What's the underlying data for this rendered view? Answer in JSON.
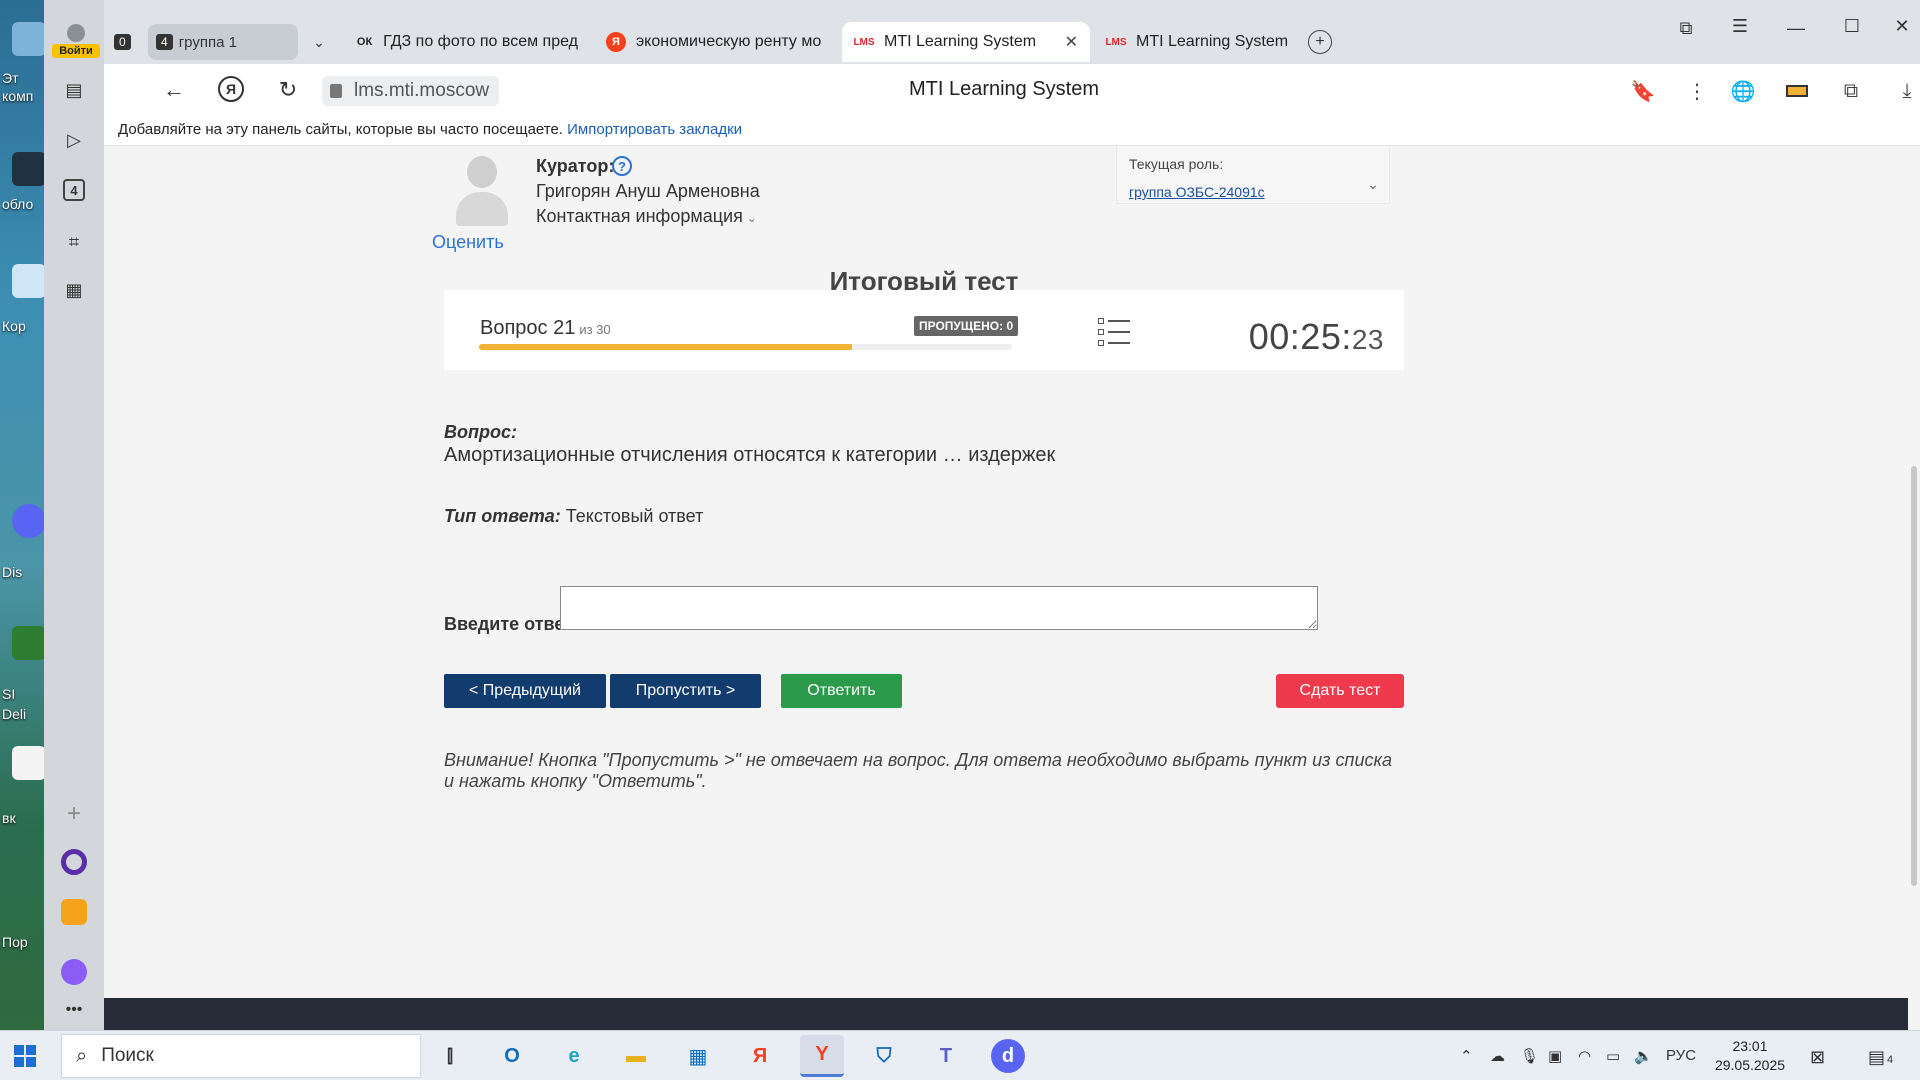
{
  "desktop": {
    "labels": [
      "Эт",
      "комп",
      "обло",
      "Кор",
      "Dis",
      "SI",
      "Deli",
      "вк",
      "Пор"
    ]
  },
  "browser": {
    "login_label": "Войти",
    "tab_group": {
      "count": "4",
      "label": "группа 1"
    },
    "tab_counter": "0",
    "tabs": [
      {
        "label": "ГДЗ по фото по всем пред",
        "icon": "ok-icon",
        "icon_text": "ОК"
      },
      {
        "label": "экономическую ренту мо",
        "icon": "yandex-icon",
        "icon_text": "Я"
      },
      {
        "label": "MTI Learning System",
        "icon": "lms-icon",
        "icon_text": "LMS",
        "active": true
      },
      {
        "label": "MTI Learning System",
        "icon": "lms-icon",
        "icon_text": "LMS"
      }
    ],
    "url": "lms.mti.moscow",
    "page_title": "MTI Learning System",
    "bookmarks_text": "Добавляйте на эту панель сайты, которые вы часто посещаете.",
    "bookmarks_link": "Импортировать закладки",
    "rail_badge": "4"
  },
  "curator": {
    "label": "Куратор:",
    "name": "Григорян Ануш Арменовна",
    "contact": "Контактная информация",
    "rate": "Оценить"
  },
  "role": {
    "label": "Текущая роль:",
    "value": "группа ОЗБС-24091с"
  },
  "test": {
    "title": "Итоговый тест",
    "question_label": "Вопрос 21",
    "question_of": "из 30",
    "current": 21,
    "total": 30,
    "skipped": "ПРОПУЩЕНО: 0",
    "timer_main": "00:25:",
    "timer_sec": "23",
    "q_heading": "Вопрос:",
    "q_text": "Амортизационные отчисления относятся к категории … издержек",
    "answer_type_label": "Тип ответа:",
    "answer_type_value": "Текстовый ответ",
    "enter_label": "Введите ответ:",
    "answer_value": "",
    "btn_prev": "< Предыдущий",
    "btn_skip": "Пропустить >",
    "btn_answer": "Ответить",
    "btn_submit": "Сдать тест",
    "notice": "Внимание! Кнопка \"Пропустить >\" не отвечает на вопрос. Для ответа необходимо выбрать пункт из списка и нажать кнопку \"Ответить\"."
  },
  "taskbar": {
    "search_placeholder": "Поиск",
    "lang": "РУС",
    "time": "23:01",
    "date": "29.05.2025",
    "notif_count": "4"
  },
  "colors": {
    "navy_button": "#123b6e",
    "green_button": "#2b9a4a",
    "red_button": "#ef3a4d",
    "progress_fill": "#f2b233",
    "link_blue": "#2b72d6"
  }
}
